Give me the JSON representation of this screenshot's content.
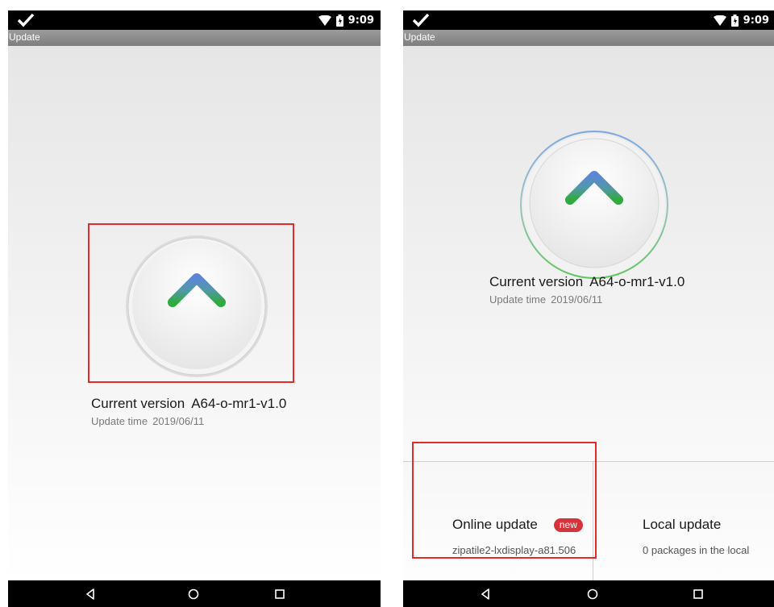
{
  "left": {
    "status": {
      "time": "9:09"
    },
    "title": "Update",
    "version": {
      "label": "Current version",
      "value": "A64-o-mr1-v1.0"
    },
    "update_time": {
      "label": "Update time",
      "value": "2019/06/11"
    }
  },
  "right": {
    "status": {
      "time": "9:09"
    },
    "title": "Update",
    "version": {
      "label": "Current version",
      "value": "A64-o-mr1-v1.0"
    },
    "update_time": {
      "label": "Update time",
      "value": "2019/06/11"
    },
    "online_update": {
      "title": "Online update",
      "badge": "new",
      "detail": "zipatile2-lxdisplay-a81.506"
    },
    "local_update": {
      "title": "Local update",
      "detail": "0 packages in the local"
    }
  },
  "icons": [
    "check-icon",
    "wifi-icon",
    "battery-icon",
    "arrow-up-icon",
    "back-icon",
    "home-icon",
    "recents-icon"
  ],
  "colors": {
    "highlight": "#e32b2b",
    "badge": "#d8323a",
    "arrow_top": "#5b86d6",
    "arrow_bottom": "#2faa3b",
    "ring_blue": "#7ba7e0",
    "ring_green": "#5cc55a"
  }
}
